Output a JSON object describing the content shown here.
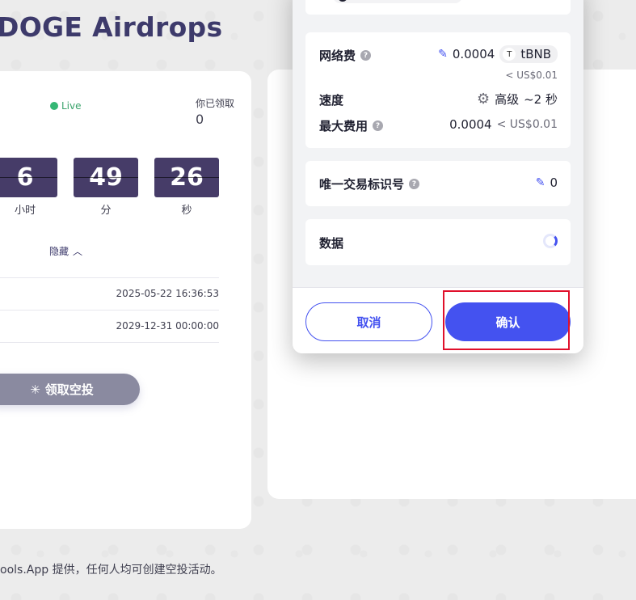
{
  "page": {
    "title": "DOGE Airdrops"
  },
  "airdrop": {
    "live_label": "Live",
    "claimed_label": "你已领取",
    "claimed_value": "0",
    "countdown": [
      {
        "value": "6",
        "unit": "小时"
      },
      {
        "value": "49",
        "unit": "分"
      },
      {
        "value": "26",
        "unit": "秒"
      }
    ],
    "hide_label": "隐藏",
    "dates": [
      "2025-05-22 16:36:53",
      "2029-12-31 00:00:00"
    ],
    "claim_button": "领取空投"
  },
  "footer": {
    "line1": "ools.App 提供，任何人均可创建空投活动。"
  },
  "modal": {
    "network_fee": {
      "label": "网络费",
      "amount": "0.0004",
      "token_badge": "T",
      "token": "tBNB",
      "usd": "< US$0.01"
    },
    "speed": {
      "label": "速度",
      "value": "高级",
      "time": "~2 秒"
    },
    "max_fee": {
      "label": "最大费用",
      "amount": "0.0004",
      "usd": "< US$0.01"
    },
    "nonce": {
      "label": "唯一交易标识号",
      "value": "0"
    },
    "data": {
      "label": "数据"
    },
    "buttons": {
      "cancel": "取消",
      "confirm": "确认"
    }
  },
  "colors": {
    "accent": "#4452f0",
    "highlight": "#e0102b",
    "timer_bg": "#463c68"
  }
}
